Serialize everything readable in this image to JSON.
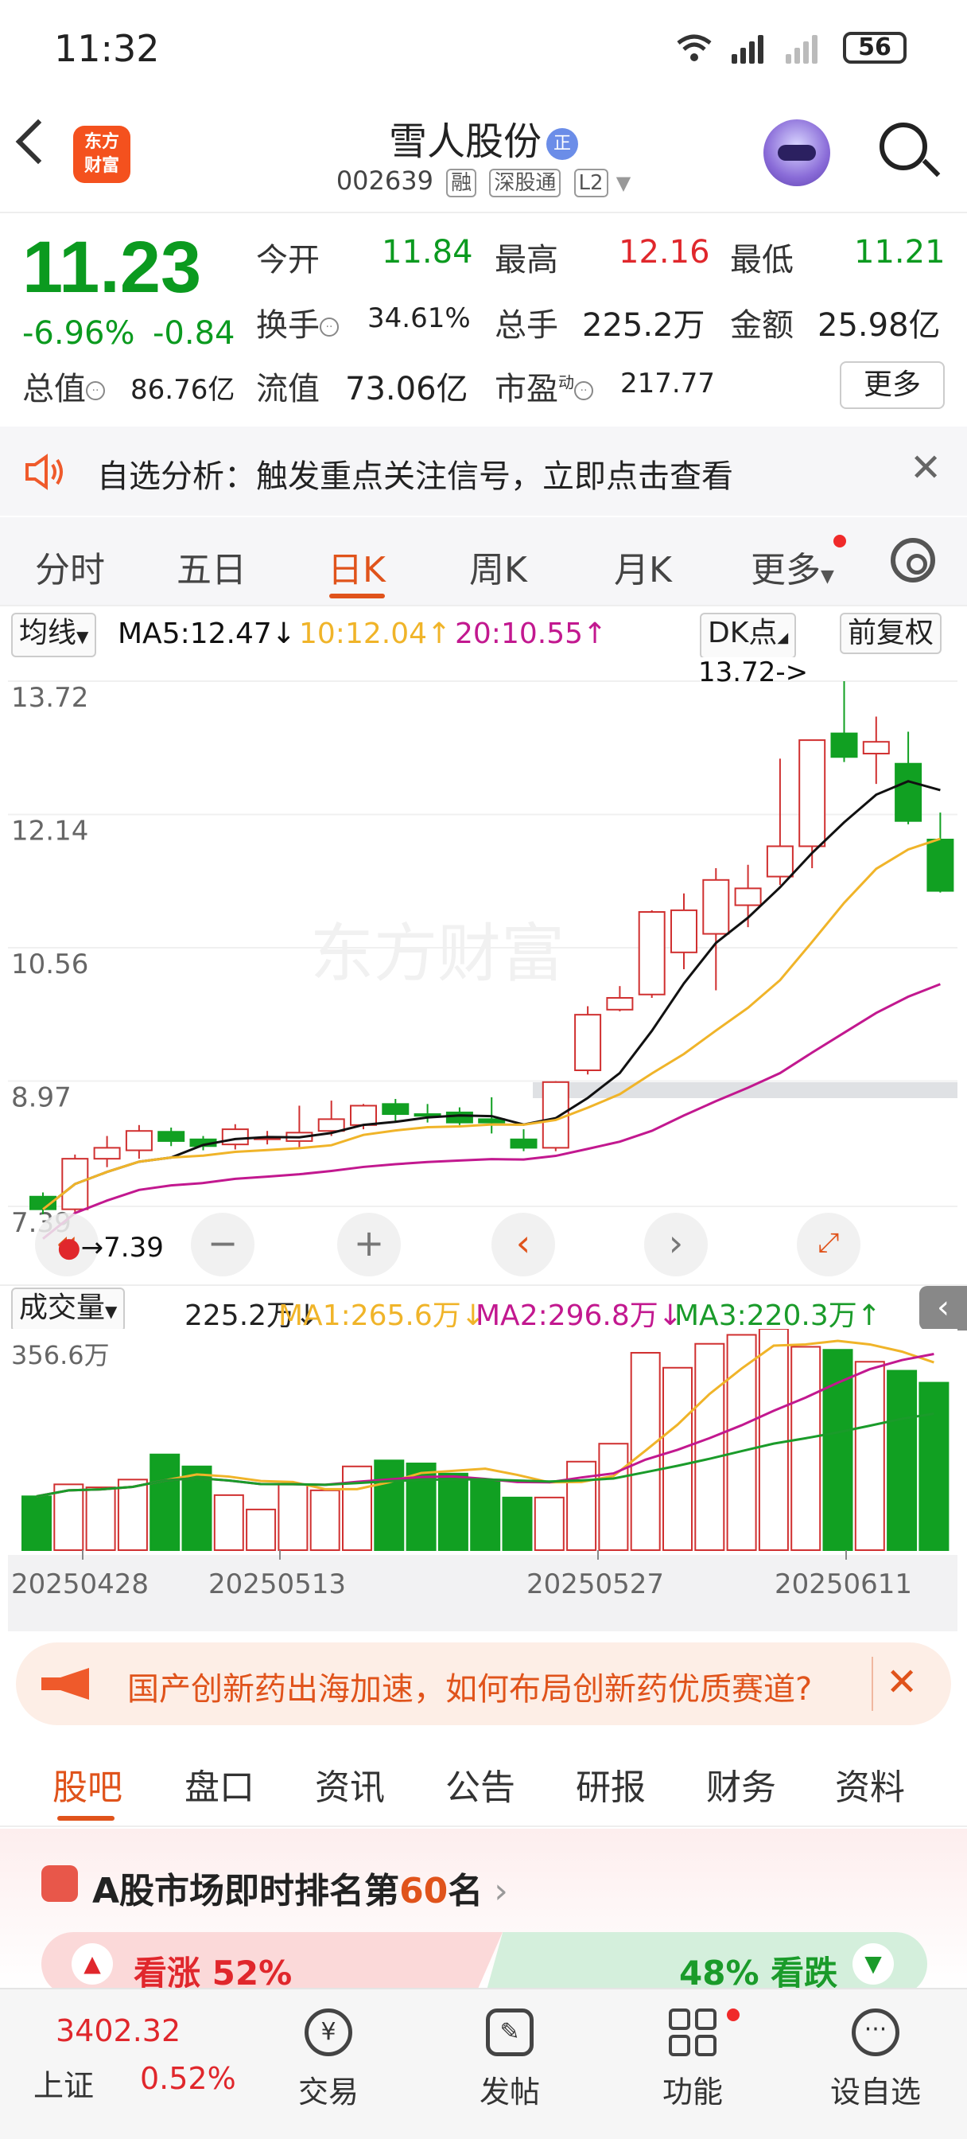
{
  "status_bar": {
    "time": "11:32",
    "battery": "56"
  },
  "header": {
    "logo_line1": "东方",
    "logo_line2": "财富",
    "stock_name": "雪人股份",
    "badge": "正",
    "code": "002639",
    "tags": [
      "融",
      "深股通",
      "L2"
    ]
  },
  "quote": {
    "price": "11.23",
    "change_pct": "-6.96%",
    "change": "-0.84",
    "rows": [
      [
        {
          "label": "今开",
          "value": "11.84",
          "color": "green"
        },
        {
          "label": "最高",
          "value": "12.16",
          "color": "red"
        },
        {
          "label": "最低",
          "value": "11.21",
          "color": "green"
        }
      ],
      [
        {
          "label": "换手",
          "value": "34.61%",
          "color": "dark"
        },
        {
          "label": "总手",
          "value": "225.2万",
          "color": "dark"
        },
        {
          "label": "金额",
          "value": "25.98亿",
          "color": "dark"
        }
      ],
      [
        {
          "label": "总值",
          "value": "86.76亿",
          "color": "dark"
        },
        {
          "label": "流值",
          "value": "73.06亿",
          "color": "dark"
        },
        {
          "label": "市盈",
          "value": "217.77",
          "color": "dark"
        }
      ]
    ],
    "pe_sup": "动",
    "more": "更多"
  },
  "notice": {
    "text": "自选分析：触发重点关注信号，立即点击查看"
  },
  "tabs": {
    "items": [
      "分时",
      "五日",
      "日K",
      "周K",
      "月K",
      "更多"
    ],
    "active": "日K"
  },
  "ma_row": {
    "select": "均线",
    "ma5": "MA5:12.47↓",
    "ma10": "10:12.04↑",
    "ma20": "20:10.55↑",
    "dk": "DK点",
    "fq": "前复权",
    "colors": {
      "ma5": "#111111",
      "ma10": "#f0b429",
      "ma20": "#c2188f"
    }
  },
  "kchart": {
    "y_labels": [
      "13.72",
      "12.14",
      "10.56",
      "8.97",
      "7.39"
    ],
    "high_marker": "13.72->",
    "low_marker": "7.39",
    "watermark": "东方财富"
  },
  "vol_row": {
    "select": "成交量",
    "vol": "225.2万↓",
    "ma1": "MA1:265.6万↓",
    "ma2": "MA2:296.8万↓",
    "ma3": "MA3:220.3万↑",
    "max_label": "356.6万",
    "dates": [
      "20250428",
      "20250513",
      "20250527",
      "20250611"
    ]
  },
  "chart_data": {
    "type": "candlestick",
    "ylim": [
      7.39,
      13.72
    ],
    "candles": [
      {
        "o": 7.6,
        "h": 7.65,
        "l": 7.39,
        "c": 7.45
      },
      {
        "o": 7.45,
        "h": 8.1,
        "l": 7.42,
        "c": 8.05
      },
      {
        "o": 8.05,
        "h": 8.32,
        "l": 7.95,
        "c": 8.18
      },
      {
        "o": 8.15,
        "h": 8.45,
        "l": 8.05,
        "c": 8.38
      },
      {
        "o": 8.37,
        "h": 8.42,
        "l": 8.2,
        "c": 8.26
      },
      {
        "o": 8.28,
        "h": 8.32,
        "l": 8.15,
        "c": 8.2
      },
      {
        "o": 8.22,
        "h": 8.46,
        "l": 8.16,
        "c": 8.4
      },
      {
        "o": 8.3,
        "h": 8.38,
        "l": 8.22,
        "c": 8.3
      },
      {
        "o": 8.26,
        "h": 8.68,
        "l": 8.18,
        "c": 8.36
      },
      {
        "o": 8.38,
        "h": 8.74,
        "l": 8.32,
        "c": 8.52
      },
      {
        "o": 8.45,
        "h": 8.7,
        "l": 8.4,
        "c": 8.68
      },
      {
        "o": 8.7,
        "h": 8.76,
        "l": 8.5,
        "c": 8.58
      },
      {
        "o": 8.58,
        "h": 8.7,
        "l": 8.48,
        "c": 8.56
      },
      {
        "o": 8.6,
        "h": 8.66,
        "l": 8.45,
        "c": 8.48
      },
      {
        "o": 8.52,
        "h": 8.78,
        "l": 8.35,
        "c": 8.48
      },
      {
        "o": 8.28,
        "h": 8.4,
        "l": 8.14,
        "c": 8.18
      },
      {
        "o": 8.18,
        "h": 8.97,
        "l": 8.14,
        "c": 8.96
      },
      {
        "o": 9.1,
        "h": 9.86,
        "l": 9.05,
        "c": 9.76
      },
      {
        "o": 9.82,
        "h": 10.1,
        "l": 9.8,
        "c": 9.96
      },
      {
        "o": 10.0,
        "h": 11.0,
        "l": 9.96,
        "c": 10.98
      },
      {
        "o": 10.5,
        "h": 11.2,
        "l": 10.3,
        "c": 11.0
      },
      {
        "o": 10.72,
        "h": 11.5,
        "l": 10.05,
        "c": 11.36
      },
      {
        "o": 11.06,
        "h": 11.54,
        "l": 10.8,
        "c": 11.26
      },
      {
        "o": 11.4,
        "h": 12.8,
        "l": 11.3,
        "c": 11.76
      },
      {
        "o": 11.76,
        "h": 12.48,
        "l": 11.5,
        "c": 13.02
      },
      {
        "o": 13.1,
        "h": 13.72,
        "l": 12.76,
        "c": 12.82
      },
      {
        "o": 12.86,
        "h": 13.3,
        "l": 12.5,
        "c": 13.0
      },
      {
        "o": 12.74,
        "h": 13.12,
        "l": 12.02,
        "c": 12.06
      },
      {
        "o": 11.84,
        "h": 12.16,
        "l": 11.21,
        "c": 11.23
      }
    ],
    "volume": [
      90,
      110,
      105,
      118,
      160,
      140,
      92,
      68,
      110,
      100,
      140,
      150,
      145,
      128,
      118,
      88,
      88,
      148,
      178,
      330,
      305,
      345,
      360,
      370,
      340,
      335,
      315,
      300,
      280
    ],
    "vol_ylim": [
      0,
      356.6
    ]
  },
  "banner": {
    "text": "国产创新药出海加速，如何布局创新药优质赛道?"
  },
  "bottom_tabs": {
    "items": [
      "股吧",
      "盘口",
      "资讯",
      "公告",
      "研报",
      "财务",
      "资料"
    ],
    "active": "股吧"
  },
  "rank": {
    "prefix": "A股市场即时排名第",
    "num": "60",
    "suffix": "名",
    "up": "看涨 52%",
    "down": "48% 看跌",
    "up_pct": 52
  },
  "nav": {
    "index_value": "3402.32",
    "index_name": "上证",
    "index_change": "0.52%",
    "items": [
      "交易",
      "发帖",
      "功能",
      "设自选"
    ]
  }
}
